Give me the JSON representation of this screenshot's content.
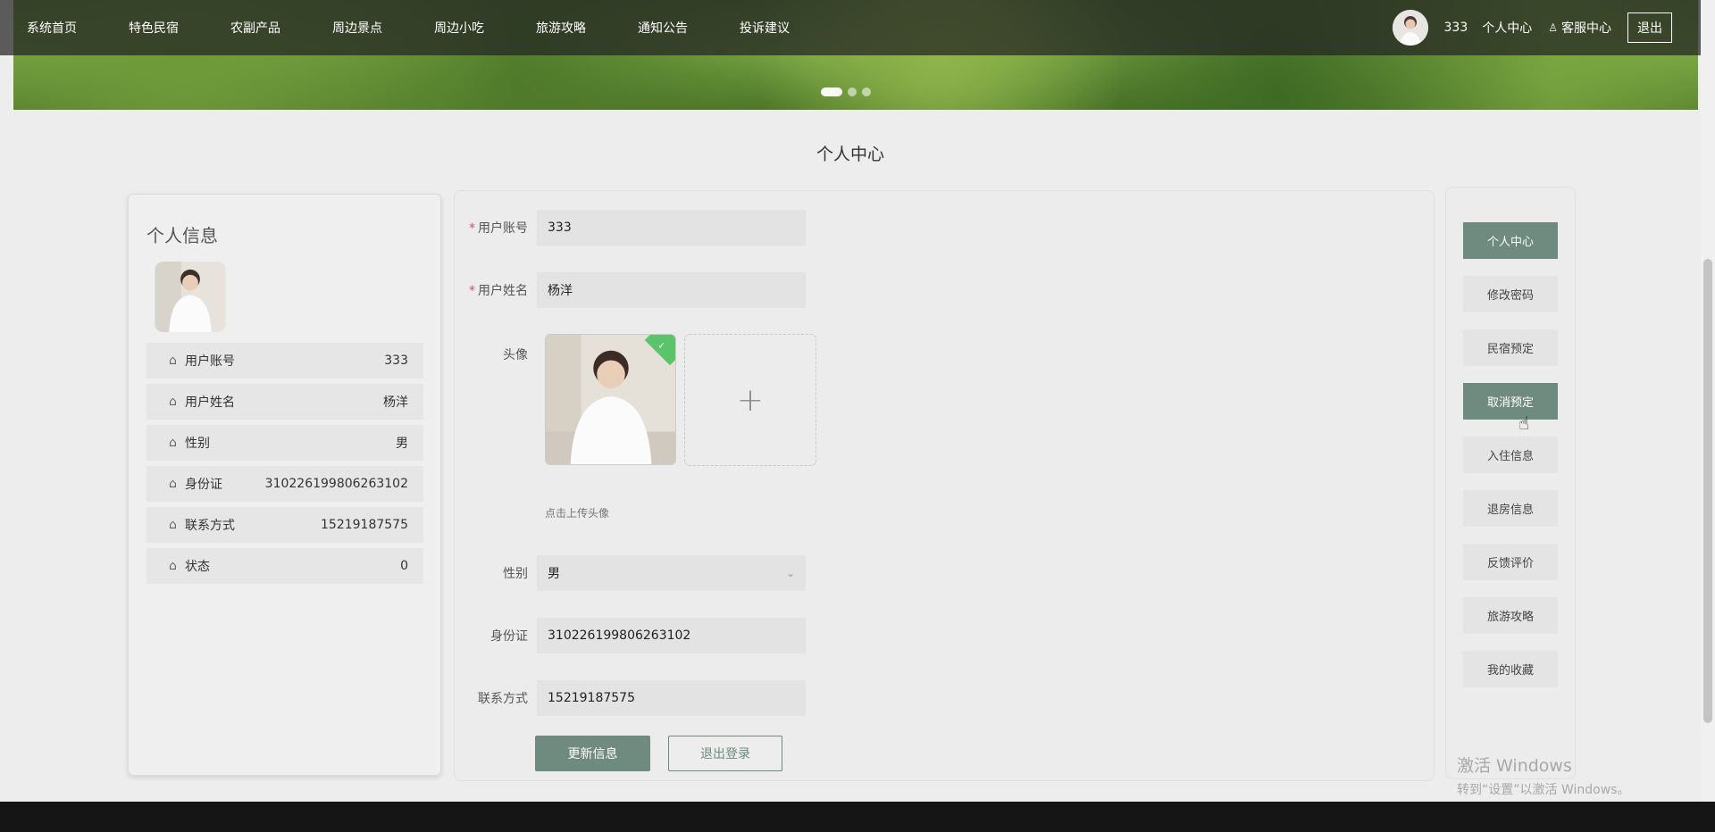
{
  "nav": {
    "items": [
      "系统首页",
      "特色民宿",
      "农副产品",
      "周边景点",
      "周边小吃",
      "旅游攻略",
      "通知公告",
      "投诉建议"
    ],
    "username": "333",
    "personal_center": "个人中心",
    "service_center": "客服中心",
    "logout": "退出"
  },
  "page": {
    "title": "个人中心"
  },
  "profile_card": {
    "title": "个人信息",
    "rows": [
      {
        "label": "用户账号",
        "value": "333"
      },
      {
        "label": "用户姓名",
        "value": "杨洋"
      },
      {
        "label": "性别",
        "value": "男"
      },
      {
        "label": "身份证",
        "value": "310226199806263102"
      },
      {
        "label": "联系方式",
        "value": "15219187575"
      },
      {
        "label": "状态",
        "value": "0"
      }
    ]
  },
  "form": {
    "account_label": "用户账号",
    "account_value": "333",
    "name_label": "用户姓名",
    "name_value": "杨洋",
    "avatar_label": "头像",
    "upload_hint": "点击上传头像",
    "gender_label": "性别",
    "gender_value": "男",
    "id_label": "身份证",
    "id_value": "310226199806263102",
    "phone_label": "联系方式",
    "phone_value": "15219187575",
    "update_button": "更新信息",
    "logout_button": "退出登录"
  },
  "side_menu": [
    {
      "label": "个人中心",
      "active": true
    },
    {
      "label": "修改密码",
      "active": false
    },
    {
      "label": "民宿预定",
      "active": false
    },
    {
      "label": "取消预定",
      "active": true
    },
    {
      "label": "入住信息",
      "active": false
    },
    {
      "label": "退房信息",
      "active": false
    },
    {
      "label": "反馈评价",
      "active": false
    },
    {
      "label": "旅游攻略",
      "active": false
    },
    {
      "label": "我的收藏",
      "active": false
    }
  ],
  "watermark": {
    "line1": "激活 Windows",
    "line2": "转到“设置”以激活 Windows。"
  },
  "colors": {
    "accent": "#6f8a7e",
    "nav_bg": "#232323",
    "check": "#5bc46a"
  }
}
